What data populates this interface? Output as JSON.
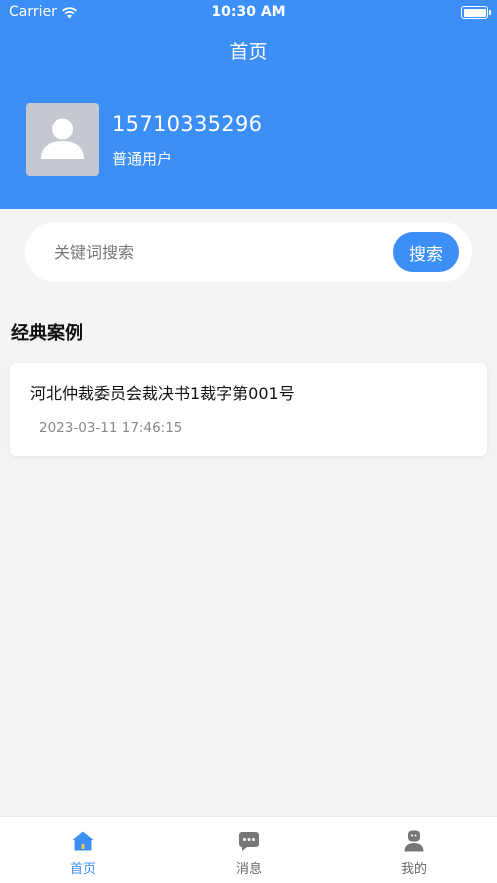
{
  "status_bar": {
    "carrier": "Carrier",
    "time": "10:30 AM"
  },
  "header": {
    "title": "首页"
  },
  "user": {
    "phone": "15710335296",
    "role": "普通用户"
  },
  "search": {
    "placeholder": "关键词搜索",
    "button_label": "搜索"
  },
  "section": {
    "title": "经典案例"
  },
  "cases": [
    {
      "title": "河北仲裁委员会裁决书1裁字第001号",
      "time": "2023-03-11 17:46:15"
    }
  ],
  "tabs": [
    {
      "label": "首页",
      "icon": "home-icon"
    },
    {
      "label": "消息",
      "icon": "message-icon"
    },
    {
      "label": "我的",
      "icon": "profile-icon"
    }
  ],
  "colors": {
    "primary": "#3d8ff8",
    "background": "#f4f4f4",
    "inactive": "#666666"
  }
}
